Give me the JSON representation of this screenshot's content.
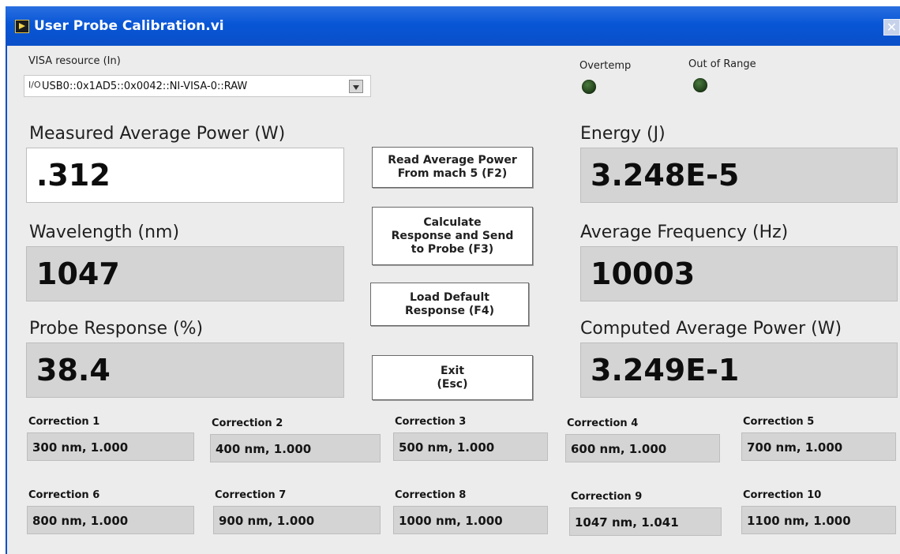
{
  "window": {
    "title": "User Probe Calibration.vi",
    "close_icon": "close-icon"
  },
  "visa": {
    "label": "VISA resource (In)",
    "io_glyph": "I/O",
    "value": "USB0::0x1AD5::0x0042::NI-VISA-0::RAW"
  },
  "indicators": {
    "overtemp": "Overtemp",
    "out_of_range": "Out of Range"
  },
  "measured_power": {
    "label": "Measured Average Power (W)",
    "value": ".312"
  },
  "wavelength": {
    "label": "Wavelength (nm)",
    "value": "1047"
  },
  "probe_response": {
    "label": "Probe Response (%)",
    "value": "38.4"
  },
  "energy": {
    "label": "Energy (J)",
    "value": "3.248E-5"
  },
  "avg_frequency": {
    "label": "Average Frequency (Hz)",
    "value": "10003"
  },
  "computed_power": {
    "label": "Computed Average Power (W)",
    "value": "3.249E-1"
  },
  "buttons": {
    "read_power": "Read Average Power\nFrom mach 5 (F2)",
    "calculate": "Calculate\nResponse and Send\nto Probe (F3)",
    "load_default": "Load  Default\nResponse (F4)",
    "exit": "Exit\n(Esc)"
  },
  "corrections": [
    {
      "label": "Correction 1",
      "value": "300 nm,  1.000"
    },
    {
      "label": "Correction 2",
      "value": "400 nm,  1.000"
    },
    {
      "label": "Correction 3",
      "value": "500 nm,  1.000"
    },
    {
      "label": "Correction 4",
      "value": "600 nm,  1.000"
    },
    {
      "label": "Correction 5",
      "value": "700 nm,  1.000"
    },
    {
      "label": "Correction 6",
      "value": "800 nm,  1.000"
    },
    {
      "label": "Correction 7",
      "value": "900 nm,  1.000"
    },
    {
      "label": "Correction 8",
      "value": "1000 nm,  1.000"
    },
    {
      "label": "Correction 9",
      "value": "1047 nm,  1.041"
    },
    {
      "label": "Correction 10",
      "value": "1100 nm,  1.000"
    }
  ],
  "colors": {
    "titlebar": "#0856d6",
    "panel": "#ececec",
    "led_off": "#2d5524",
    "field": "#d4d4d4"
  }
}
